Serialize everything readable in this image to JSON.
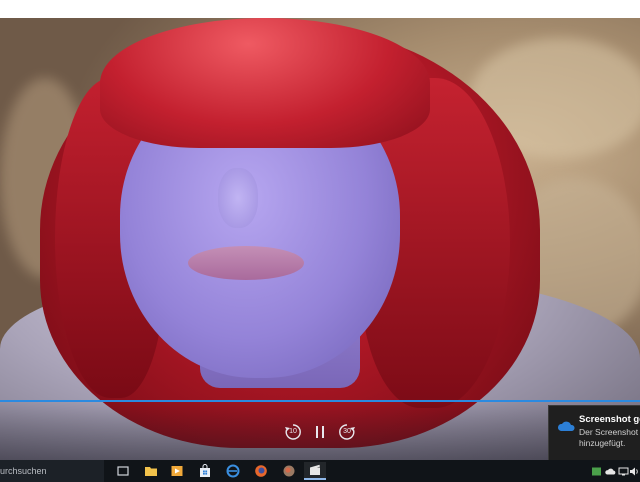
{
  "player": {
    "controls": {
      "rewind_seconds": "10",
      "forward_seconds": "30",
      "play_pause_icon": "pause-icon"
    },
    "accent_color": "#2b8ae0"
  },
  "notification": {
    "icon": "onedrive-cloud-icon",
    "title": "Screenshot gesp",
    "body_line1": "Der Screenshot w",
    "body_line2": "hinzugefügt."
  },
  "taskbar": {
    "search_text": "urchsuchen",
    "apps": [
      {
        "name": "task-view-icon"
      },
      {
        "name": "file-explorer-icon"
      },
      {
        "name": "media-app-icon"
      },
      {
        "name": "store-icon"
      },
      {
        "name": "edge-icon"
      },
      {
        "name": "firefox-icon"
      },
      {
        "name": "app-icon"
      },
      {
        "name": "movies-tv-icon",
        "active": true
      }
    ],
    "tray": [
      "app-tray-icon",
      "cloud-tray-icon",
      "network-icon",
      "volume-icon"
    ]
  }
}
